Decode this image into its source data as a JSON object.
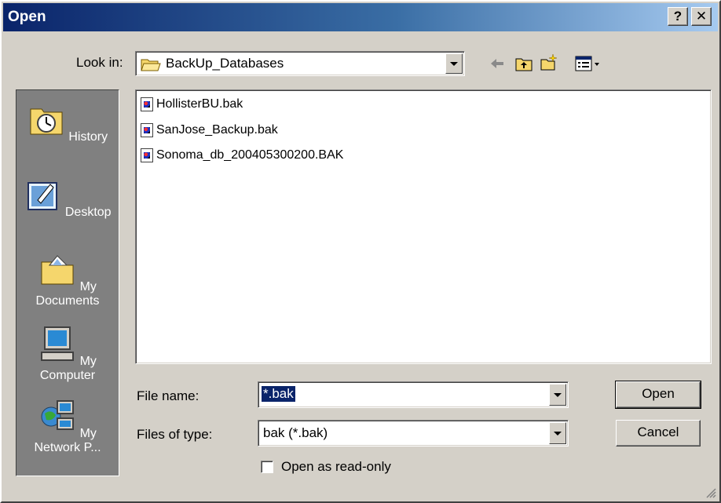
{
  "window": {
    "title": "Open",
    "help_label": "?",
    "close_label": "✕"
  },
  "toolbar": {
    "look_in_label": "Look in:",
    "look_in_value": "BackUp_Databases",
    "icons": [
      "back-arrow-icon",
      "up-folder-icon",
      "new-folder-icon",
      "view-menu-icon"
    ]
  },
  "places": [
    {
      "label": "History",
      "icon": "history-icon"
    },
    {
      "label": "Desktop",
      "icon": "desktop-icon"
    },
    {
      "label": "My Documents",
      "icon": "my-documents-icon"
    },
    {
      "label": "My Computer",
      "icon": "my-computer-icon"
    },
    {
      "label": "My Network P...",
      "icon": "my-network-places-icon"
    }
  ],
  "files": [
    {
      "name": "HollisterBU.bak"
    },
    {
      "name": "SanJose_Backup.bak"
    },
    {
      "name": "Sonoma_db_200405300200.BAK"
    }
  ],
  "file_name": {
    "label": "File name:",
    "value": "*.bak"
  },
  "file_type": {
    "label": "Files of type:",
    "value": "bak (*.bak)"
  },
  "read_only": {
    "label": "Open as read-only",
    "checked": false
  },
  "buttons": {
    "open": "Open",
    "cancel": "Cancel"
  },
  "colors": {
    "title_start": "#0a246a",
    "title_end": "#a6caf0",
    "face": "#d4d0c8",
    "places_bg": "#808080",
    "selection": "#0a246a"
  }
}
